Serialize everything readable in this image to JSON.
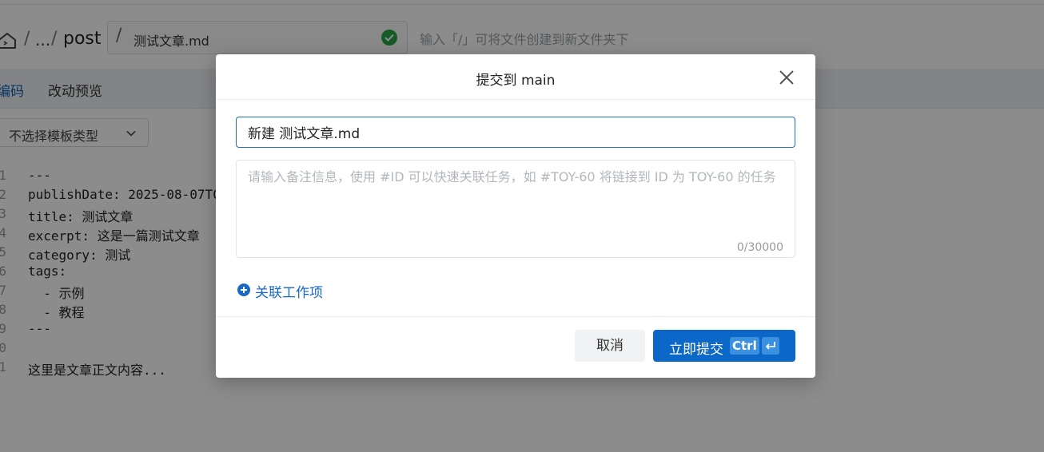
{
  "pathbar": {
    "ellipsis": "...",
    "folder": "post",
    "sep1": "/",
    "sep2": "/",
    "filename_slash": "/",
    "filename": "测试文章.md",
    "hint": "输入「/」可将文件创建到新文件夹下"
  },
  "tabs": {
    "edit": "编码",
    "preview": "改动预览"
  },
  "toolbar": {
    "template_select": "不选择模板类型"
  },
  "editor": {
    "lines": [
      {
        "no": "1",
        "code": "---"
      },
      {
        "no": "2",
        "code": "publishDate: 2025-08-07T0"
      },
      {
        "no": "3",
        "code": "title: 测试文章"
      },
      {
        "no": "4",
        "code": "excerpt: 这是一篇测试文章"
      },
      {
        "no": "5",
        "code": "category: 测试"
      },
      {
        "no": "6",
        "code": "tags:"
      },
      {
        "no": "7",
        "code": "  - 示例"
      },
      {
        "no": "8",
        "code": "  - 教程"
      },
      {
        "no": "9",
        "code": "---"
      },
      {
        "no": "0",
        "code": ""
      },
      {
        "no": "1",
        "code": "这里是文章正文内容..."
      }
    ]
  },
  "modal": {
    "title": "提交到 main",
    "commit_message": "新建 测试文章.md",
    "note_placeholder": "请输入备注信息，使用 #ID 可以快速关联任务，如 #TOY-60 将链接到 ID 为 TOY-60 的任务",
    "note_counter": "0/30000",
    "link_work_item": "关联工作项",
    "cancel": "取消",
    "submit": "立即提交",
    "submit_shortcut": "Ctrl"
  }
}
